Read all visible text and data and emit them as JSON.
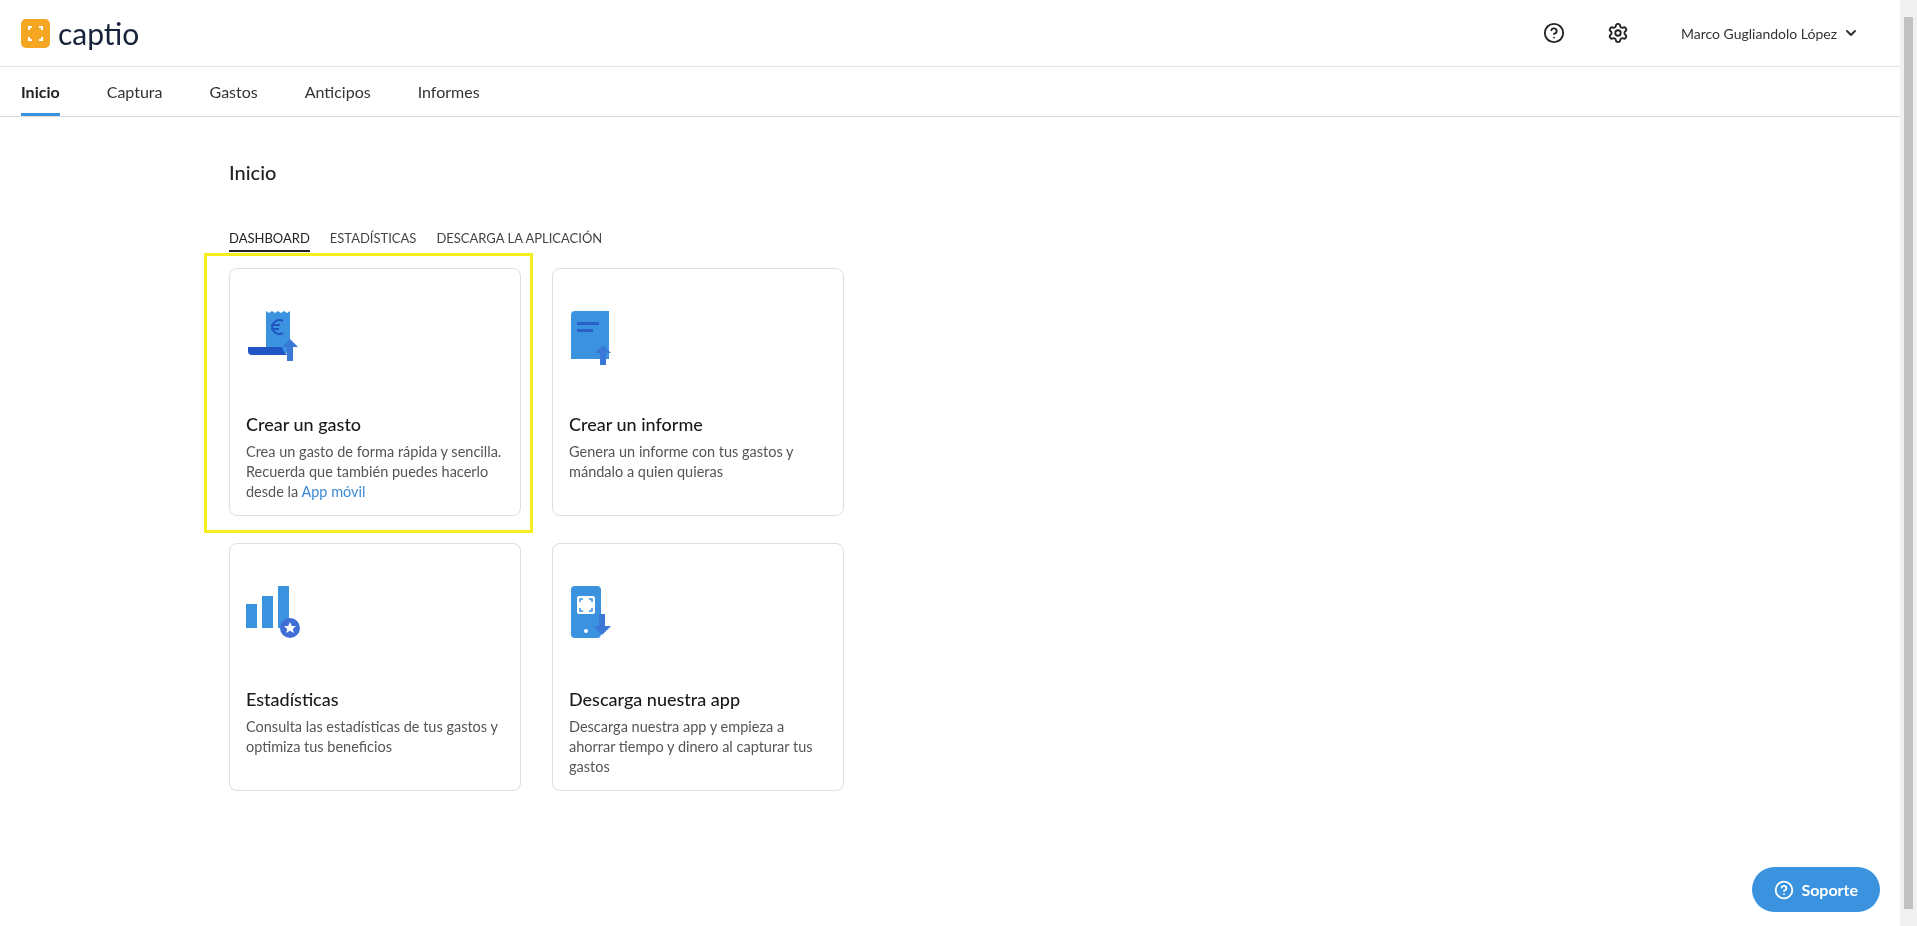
{
  "header": {
    "logo": "captio",
    "user": "Marco Gugliandolo López"
  },
  "nav": [
    {
      "label": "Inicio",
      "selected": true
    },
    {
      "label": "Captura",
      "selected": false
    },
    {
      "label": "Gastos",
      "selected": false
    },
    {
      "label": "Anticipos",
      "selected": false
    },
    {
      "label": "Informes",
      "selected": false
    }
  ],
  "page_title": "Inicio",
  "subtabs": [
    {
      "label": "DASHBOARD",
      "selected": true
    },
    {
      "label": "ESTADÍSTICAS",
      "selected": false
    },
    {
      "label": "DESCARGA LA APLICACIÓN",
      "selected": false
    }
  ],
  "cards": [
    {
      "kind": "expense",
      "title": "Crear un gasto",
      "text": "Crea un gasto de forma rápida y sencilla. Recuerda que también puedes hacerlo desde la",
      "link": "App móvil",
      "highlighted": true
    },
    {
      "kind": "report",
      "title": "Crear un informe",
      "text": "Genera un informe con tus gastos y mándalo a quien quieras",
      "highlighted": false
    },
    {
      "kind": "stats",
      "title": "Estadísticas",
      "text": "Consulta las estadísticas de tus gastos y optimiza tus beneficios",
      "highlighted": false
    },
    {
      "kind": "app",
      "title": "Descarga nuestra app",
      "text": "Descarga nuestra app y empieza a ahorrar tiempo y dinero al capturar tus gastos",
      "highlighted": false
    }
  ],
  "support_button": "Soporte"
}
